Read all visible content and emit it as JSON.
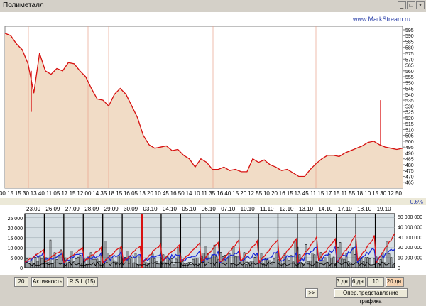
{
  "window": {
    "title": "Полиметалл",
    "website": "www.MarkStream.ru",
    "percent": "0,6%"
  },
  "main_chart": {
    "time_labels": [
      "00.15",
      "15.30",
      "13.40",
      "11.05",
      "17.15",
      "12.00",
      "14.35",
      "18.15",
      "16.05",
      "13.20",
      "10.45",
      "16.50",
      "14.10",
      "11.35",
      "16.40",
      "15.20",
      "12.55",
      "10.20",
      "16.15",
      "13.45",
      "11.15",
      "17.15",
      "11.55",
      "18.10",
      "15.30",
      "12.50"
    ],
    "price_ticks": [
      595,
      590,
      585,
      580,
      575,
      570,
      565,
      560,
      555,
      550,
      545,
      540,
      535,
      530,
      525,
      520,
      515,
      510,
      505,
      500,
      495,
      490,
      485,
      480,
      475,
      470,
      465
    ]
  },
  "lower_chart": {
    "date_labels": [
      "23.09",
      "26.09",
      "27.09",
      "28.09",
      "29.09",
      "30.09",
      "03.10",
      "04.10",
      "05.10",
      "06.10",
      "07.10",
      "10.10",
      "11.10",
      "12.10",
      "13.10",
      "14.10",
      "17.10",
      "18.10",
      "19.10"
    ],
    "left_ticks": [
      "25 000",
      "20 000",
      "15 000",
      "10 000",
      "5 000",
      "0"
    ],
    "right_ticks": [
      "50 000 000",
      "40 000 000",
      "30 000 000",
      "20 000 000",
      "10 000 000",
      "0"
    ]
  },
  "controls": {
    "period_value": "20",
    "activity_label": "Активность",
    "rsi_label": "R.S.I. (15)",
    "range_3d": "3 дн.",
    "range_6d": "6 дн.",
    "range_10d": "10 дн.",
    "range_20d": "20 дн.",
    "forward_label": ">>",
    "oper_view_label": "Опер.представление графика"
  },
  "chart_data": {
    "type": "line",
    "title": "Полиметалл",
    "x_tick_labels": [
      "00.15",
      "15.30",
      "13.40",
      "11.05",
      "17.15",
      "12.00",
      "14.35",
      "18.15",
      "16.05",
      "13.20",
      "10.45",
      "16.50",
      "14.10",
      "11.35",
      "16.40",
      "15.20",
      "12.55",
      "10.20",
      "16.15",
      "13.45",
      "11.15",
      "17.15",
      "11.55",
      "18.10",
      "15.30",
      "12.50"
    ],
    "ylim": [
      460,
      598
    ],
    "series": [
      {
        "values": [
          592,
          590,
          583,
          578,
          566,
          541,
          575,
          560,
          557,
          562,
          560,
          567,
          566,
          560,
          555,
          545,
          536,
          535,
          530,
          540,
          545,
          540,
          530,
          520,
          505,
          497,
          494,
          495,
          496,
          492,
          493,
          488,
          485,
          478,
          485,
          482,
          476,
          476,
          478,
          475,
          476,
          474,
          474,
          485,
          482,
          484,
          480,
          478,
          475,
          476,
          473,
          470,
          470,
          476,
          481,
          485,
          488,
          488,
          487,
          490,
          492,
          494,
          496,
          499,
          500,
          497,
          495,
          494,
          493,
          494
        ]
      }
    ],
    "lower": {
      "categories": [
        "23.09",
        "26.09",
        "27.09",
        "28.09",
        "29.09",
        "30.09",
        "03.10",
        "04.10",
        "05.10",
        "06.10",
        "07.10",
        "10.10",
        "11.10",
        "12.10",
        "13.10",
        "14.10",
        "17.10",
        "18.10",
        "19.10"
      ],
      "ylim_left": [
        0,
        27000
      ],
      "ylim_right": [
        0,
        54000000
      ]
    }
  }
}
